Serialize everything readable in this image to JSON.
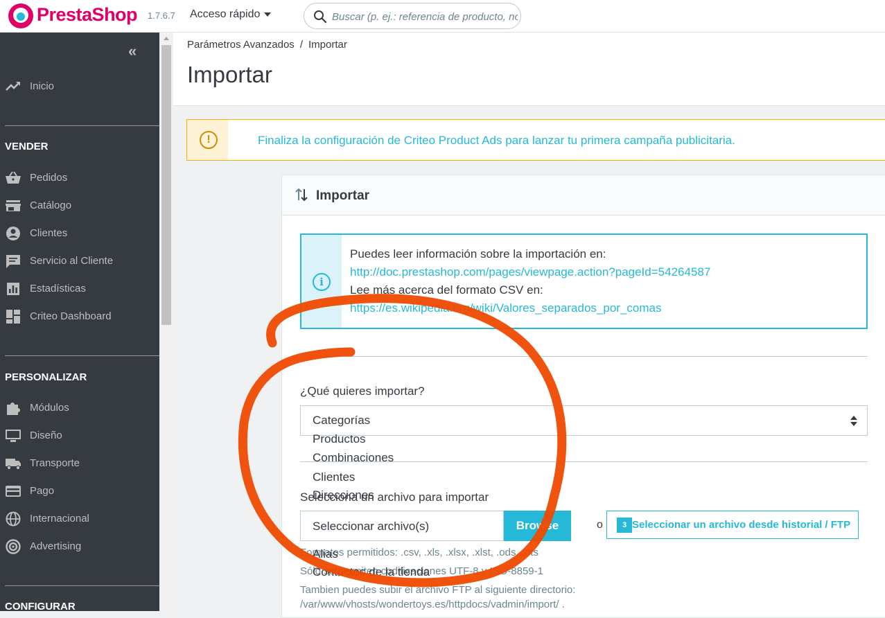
{
  "header": {
    "brand_name": "PrestaShop",
    "version": "1.7.6.7",
    "quick_access_label": "Acceso rápido",
    "search_placeholder": "Buscar (p. ej.: referencia de producto, nombre de cliente...)"
  },
  "sidebar": {
    "collapse_label": "«",
    "home": "Inicio",
    "sections": [
      {
        "title": "VENDER",
        "items": [
          "Pedidos",
          "Catálogo",
          "Clientes",
          "Servicio al Cliente",
          "Estadísticas",
          "Criteo Dashboard"
        ]
      },
      {
        "title": "PERSONALIZAR",
        "items": [
          "Módulos",
          "Diseño",
          "Transporte",
          "Pago",
          "Internacional",
          "Advertising"
        ]
      },
      {
        "title": "CONFIGURAR"
      }
    ]
  },
  "breadcrumb": {
    "parent": "Parámetros Avanzados",
    "separator": "/",
    "current": "Importar"
  },
  "page_title": "Importar",
  "alert": {
    "text": "Finaliza la configuración de Criteo Product Ads para lanzar tu primera campaña publicitaria."
  },
  "panel": {
    "title": "Importar",
    "info": {
      "line1": "Puedes leer información sobre la importación en:",
      "link1": "http://doc.prestashop.com/pages/viewpage.action?pageId=54264587",
      "line2": "Lee más acerca del formato CSV en:",
      "link2": "https://es.wikipedia.org/wiki/Valores_separados_por_comas"
    },
    "what_label": "¿Qué quieres importar?",
    "select_value": "Categorías",
    "options": [
      "Productos",
      "Combinaciones",
      "Clientes",
      "Direcciones"
    ],
    "options_bottom": [
      "Alias",
      "Contactos de la tienda"
    ],
    "file_label": "Selecciona un archivo para importar",
    "file_value": "Seleccionar archivo(s)",
    "browse_label": "Browse",
    "or_label": "o",
    "ftp_badge": "3",
    "ftp_label": "Seleccionar un archivo desde historial / FTP",
    "help": {
      "formats": "Formatos permitidos: .csv, .xls, .xlsx, .xlst, .ods, .ots",
      "encodings": "Sólo se permiten codificaciones UTF-8 y ISO-8859-1",
      "ftp_line1": "Tambien puedes subir el archivo FTP al siguiente directorio:",
      "ftp_line2": "/var/www/vhosts/wondertoys.es/httpdocs/vadmin/import/ ."
    }
  },
  "colors": {
    "brand": "#df0067",
    "accent": "#25b9d7",
    "sidebar_bg": "#363a41",
    "warning": "#fab000",
    "annotation": "#ee4a00"
  }
}
